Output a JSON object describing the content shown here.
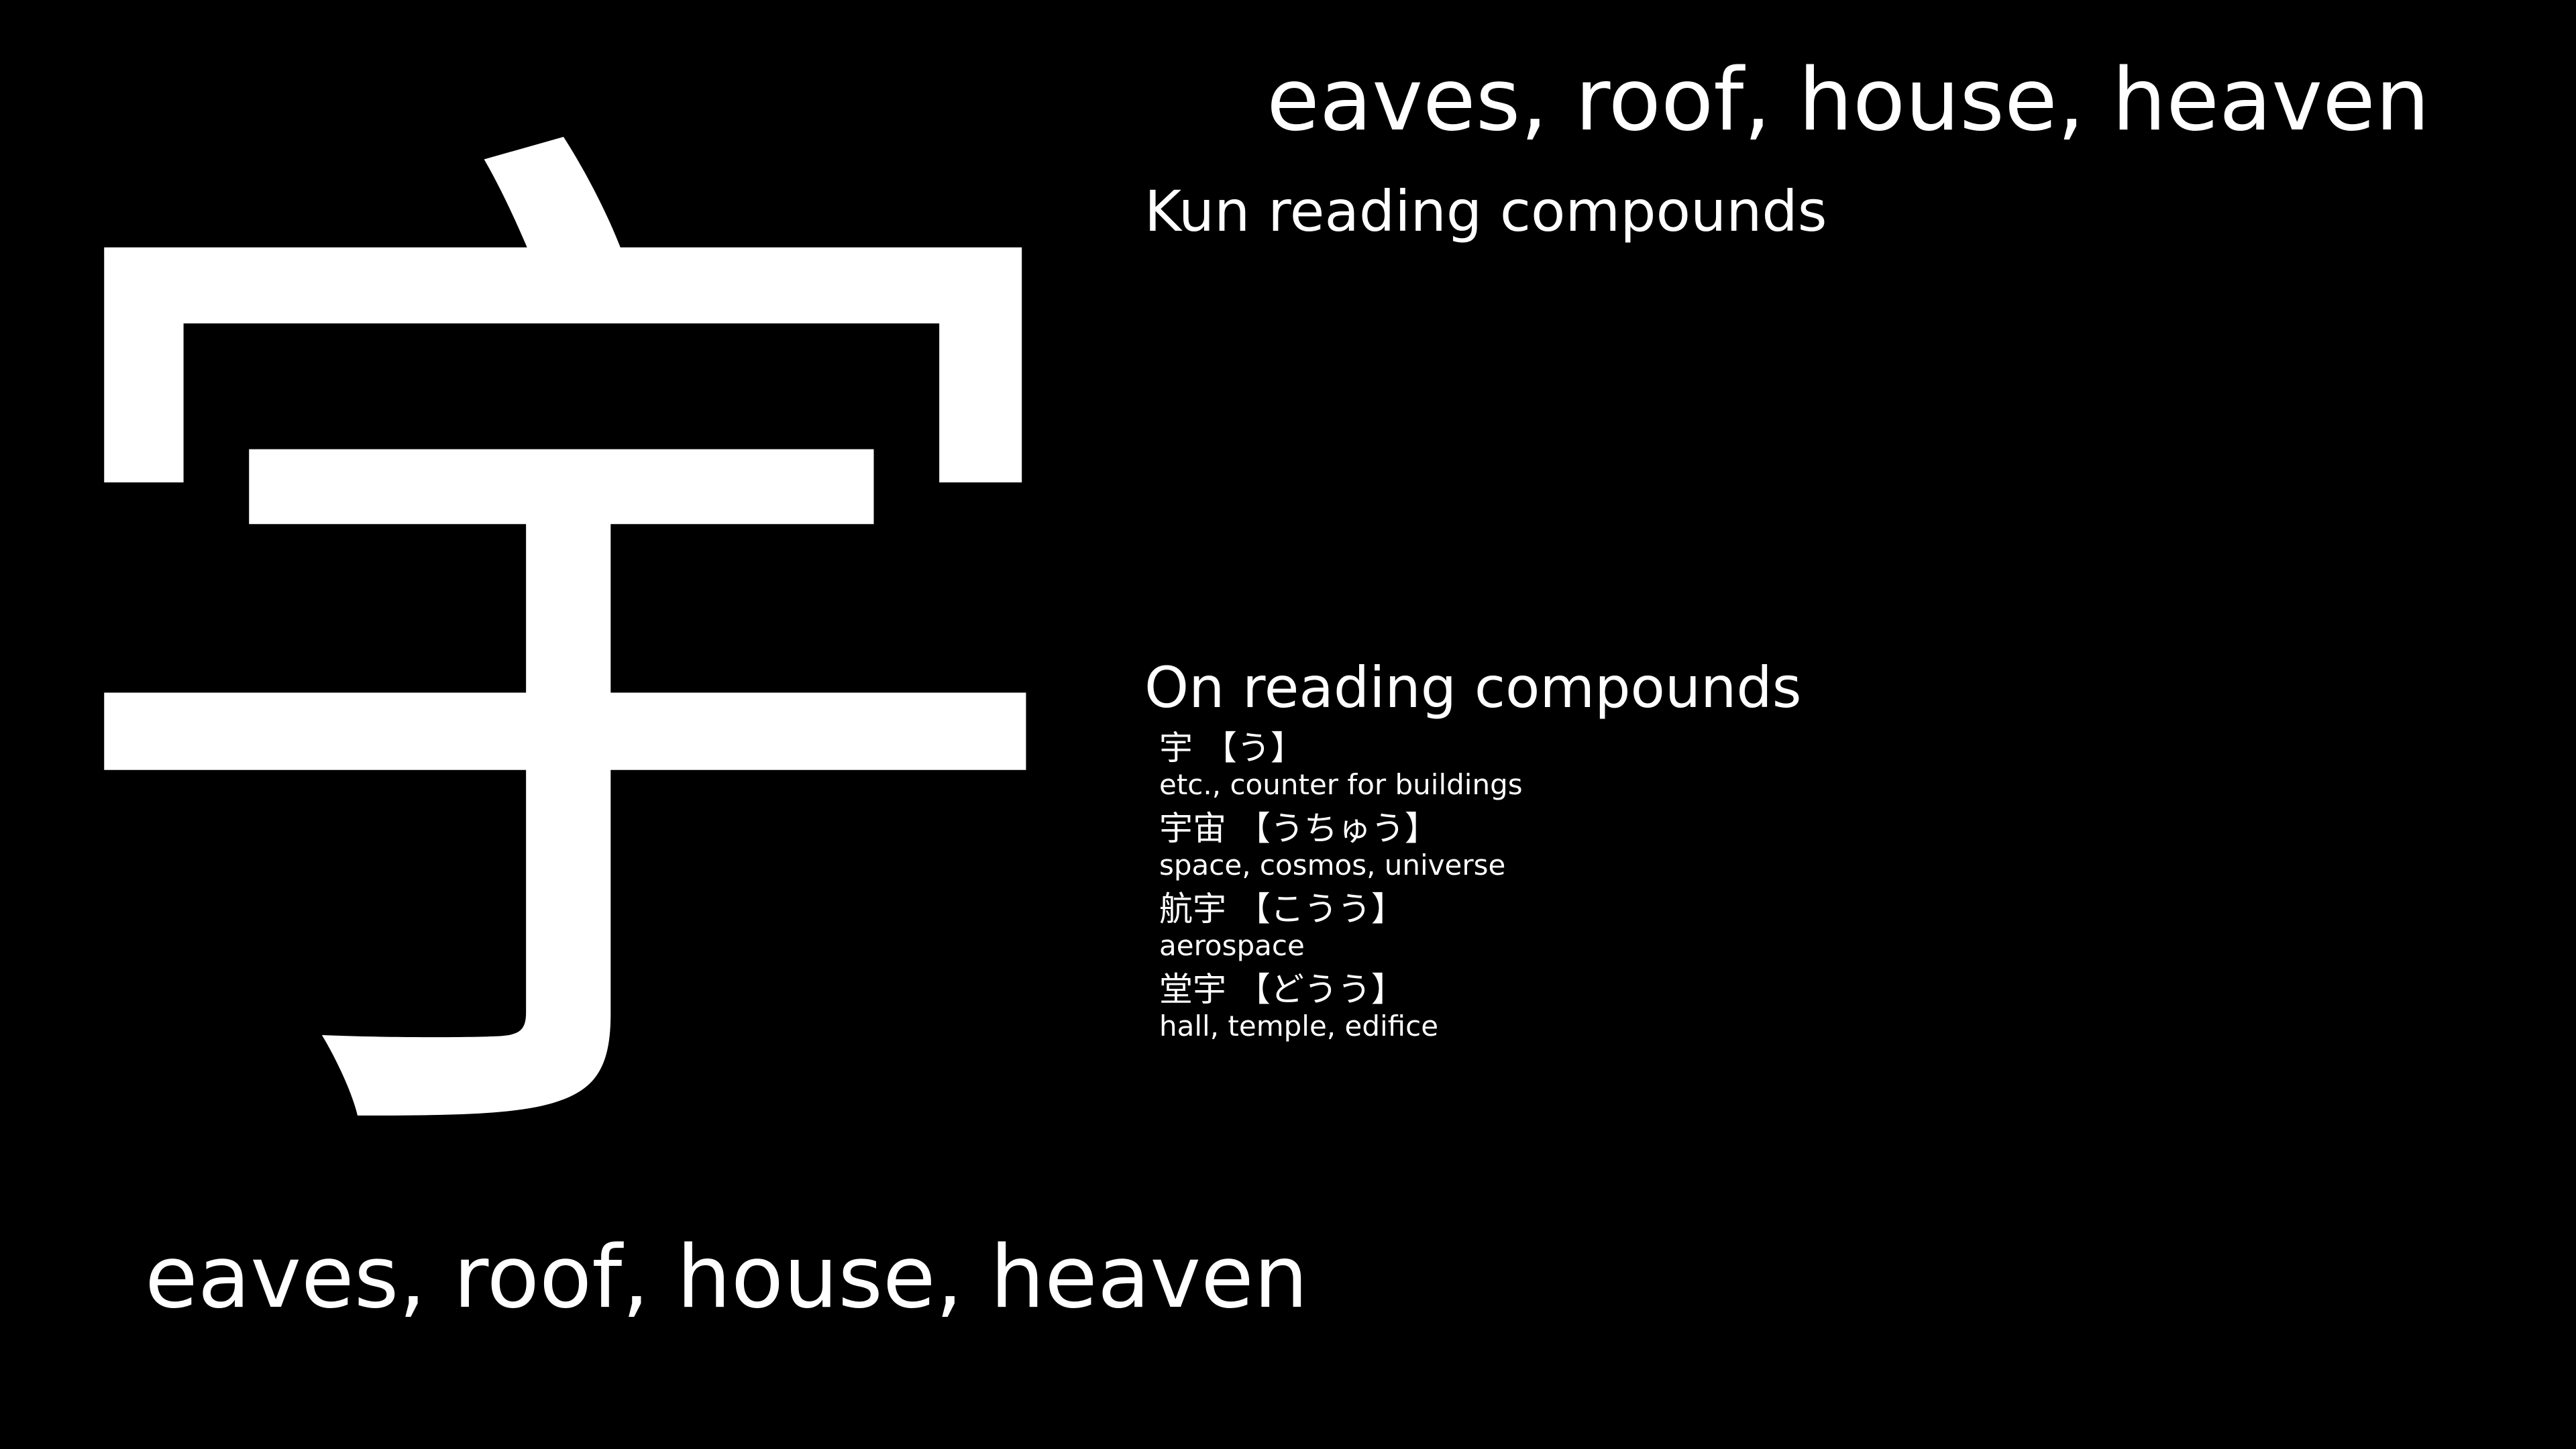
{
  "kanji": "宇",
  "meaning": "eaves, roof, house, heaven",
  "kun_section": {
    "heading": "Kun reading compounds",
    "items": []
  },
  "on_section": {
    "heading": "On reading compounds",
    "items": [
      {
        "word": "宇 【う】",
        "definition": "etc., counter for buildings"
      },
      {
        "word": "宇宙 【うちゅう】",
        "definition": "space, cosmos, universe"
      },
      {
        "word": "航宇 【こうう】",
        "definition": "aerospace"
      },
      {
        "word": "堂宇 【どうう】",
        "definition": "hall, temple, edifice"
      }
    ]
  },
  "colors": {
    "background": "#000000",
    "text": "#ffffff"
  }
}
